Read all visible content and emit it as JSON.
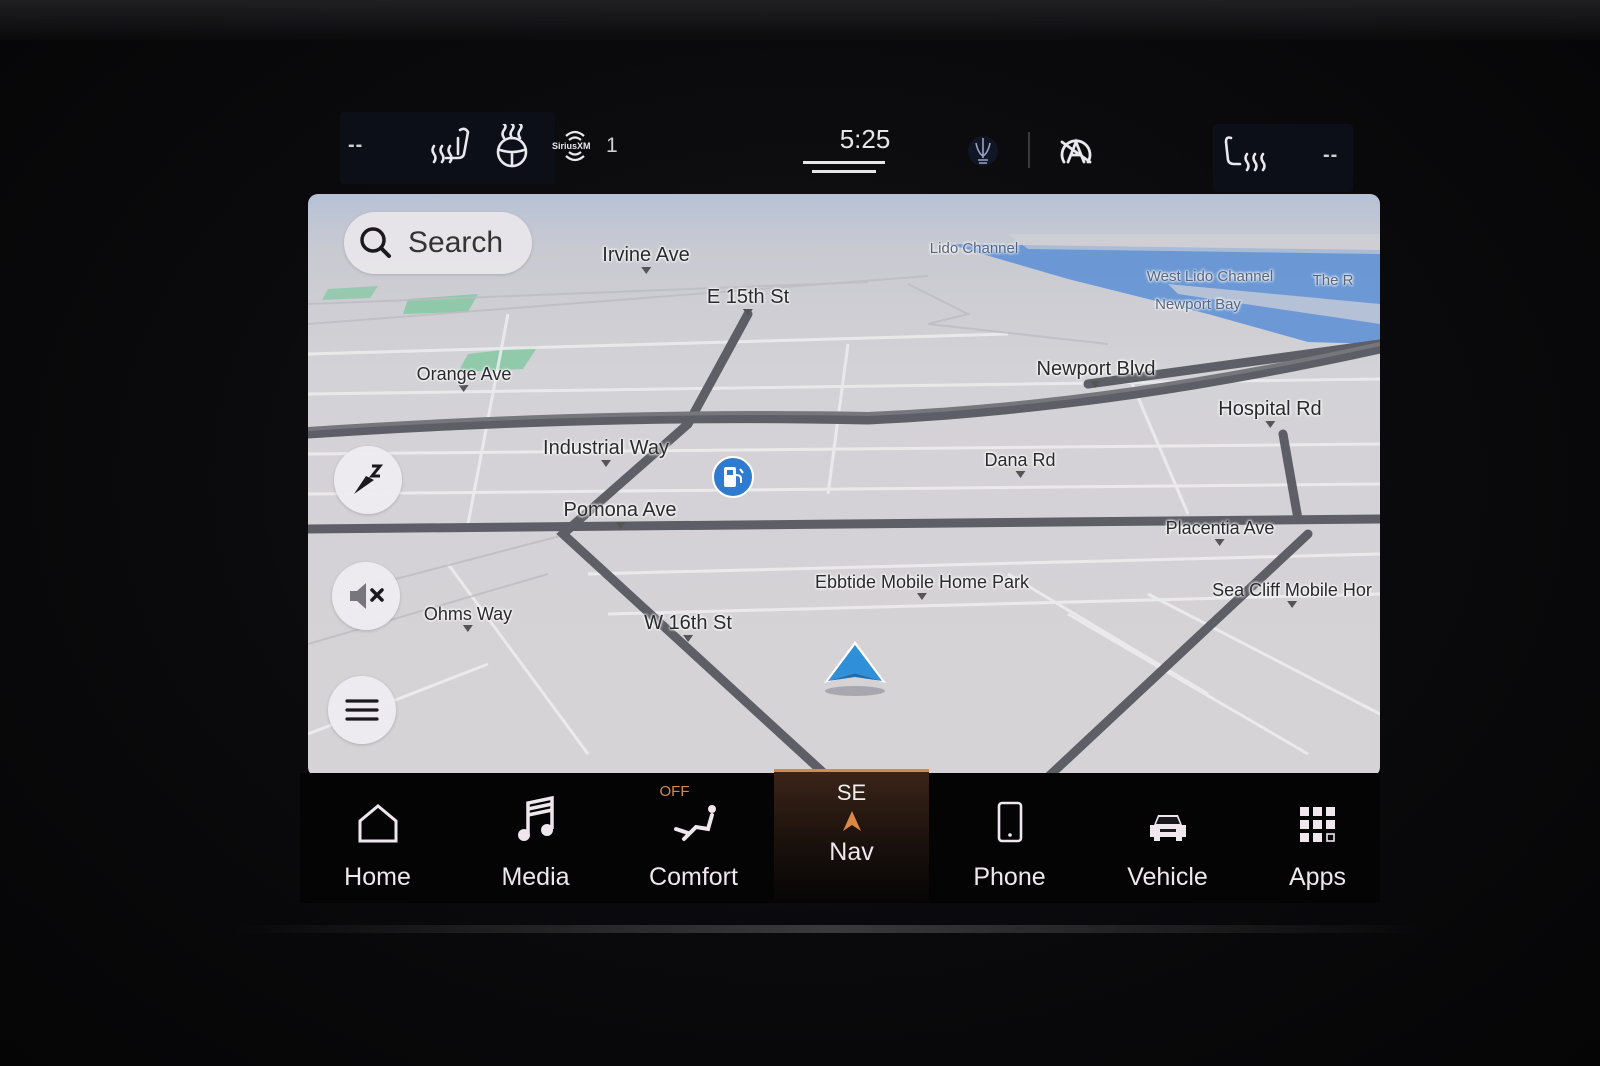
{
  "status_bar": {
    "left_temp": "--",
    "right_temp": "--",
    "radio_source": "SiriusXM",
    "radio_channel": "1",
    "time": "5:25",
    "icons": [
      "heated-seat-icon",
      "heated-steering-wheel-icon",
      "siriusxm-icon",
      "brand-trident-icon",
      "auto-stop-start-off-icon",
      "passenger-heated-seat-icon"
    ]
  },
  "map": {
    "search_label": "Search",
    "streets": [
      {
        "name": "Irvine Ave"
      },
      {
        "name": "E 15th St"
      },
      {
        "name": "Orange Ave"
      },
      {
        "name": "Newport Blvd"
      },
      {
        "name": "Hospital Rd"
      },
      {
        "name": "Industrial Way"
      },
      {
        "name": "Dana Rd"
      },
      {
        "name": "Pomona Ave"
      },
      {
        "name": "Placentia Ave"
      },
      {
        "name": "Ebbtide Mobile Home Park"
      },
      {
        "name": "Sea Cliff Mobile Hor"
      },
      {
        "name": "Ohms Way"
      },
      {
        "name": "W 16th St"
      }
    ],
    "water": [
      {
        "name": "Lido Channel"
      },
      {
        "name": "West Lido Channel"
      },
      {
        "name": "Newport Bay"
      },
      {
        "name": "The R"
      }
    ],
    "poi": {
      "type": "fuel-station-icon",
      "color": "#2f7bd0"
    },
    "controls": [
      "compass-north-icon",
      "mute-icon",
      "menu-icon"
    ],
    "vehicle_color": "#2f8fd8"
  },
  "nav_bar": {
    "items": [
      {
        "label": "Home",
        "icon": "home-icon"
      },
      {
        "label": "Media",
        "icon": "music-note-icon"
      },
      {
        "label": "Comfort",
        "icon": "comfort-seat-icon",
        "badge": "OFF"
      },
      {
        "label": "Nav",
        "icon": "heading-arrow-icon",
        "heading": "SE",
        "active": true
      },
      {
        "label": "Phone",
        "icon": "phone-icon"
      },
      {
        "label": "Vehicle",
        "icon": "vehicle-icon"
      },
      {
        "label": "Apps",
        "icon": "apps-grid-icon"
      }
    ],
    "accent": "#d88a46"
  }
}
